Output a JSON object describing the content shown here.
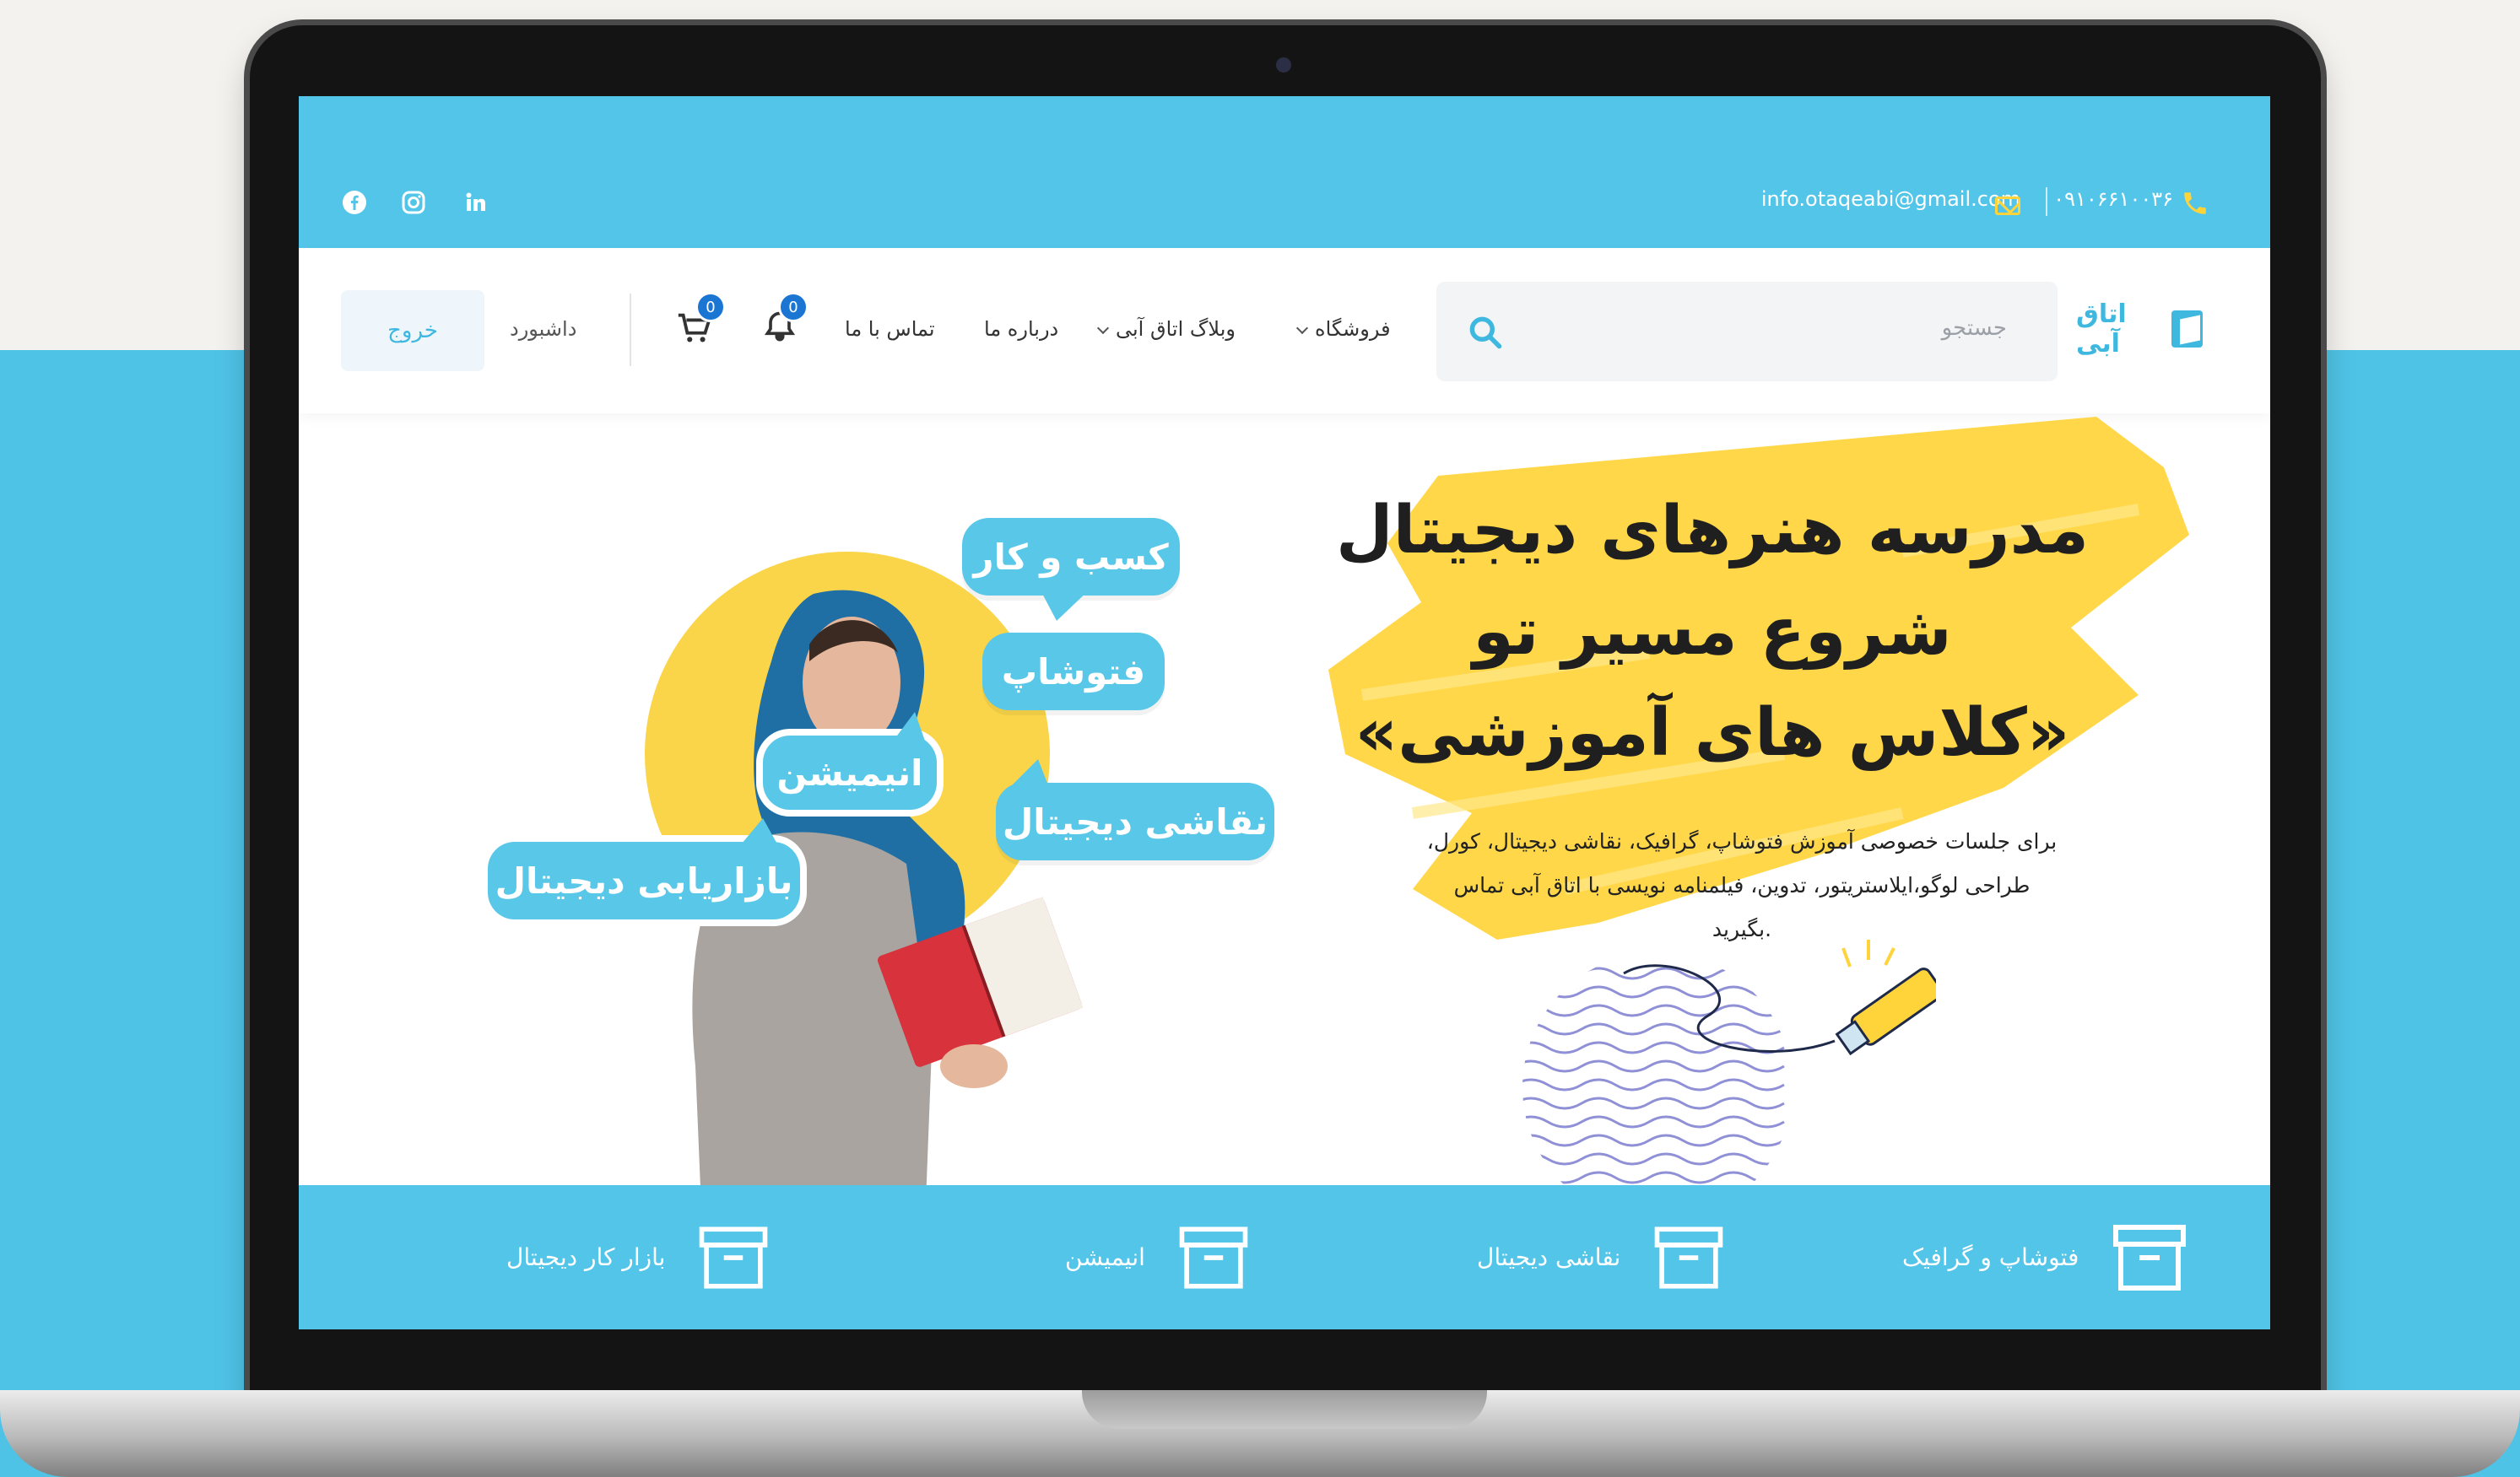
{
  "topbar": {
    "email": "info.otaqeabi@gmail.com",
    "phone": "۰۹۱۰۶۶۱۰۰۳۶",
    "social": [
      "facebook-icon",
      "instagram-icon",
      "linkedin-icon"
    ]
  },
  "header": {
    "logo_text": "اتاق آبی",
    "search_placeholder": "جستجو",
    "nav": {
      "shop": "فروشگاه",
      "blog": "وبلاگ اتاق آبی",
      "about": "درباره ما",
      "contact": "تماس با ما"
    },
    "notifications_count": "0",
    "cart_count": "0",
    "dashboard": "داشبورد",
    "logout": "خروج"
  },
  "hero": {
    "title_line1": "مدرسه هنرهای دیجیتال",
    "title_line2": "شروع مسیر تو",
    "title_line3": "«کلاس های آموزشی»",
    "description": "برای جلسات خصوصی آموزش فتوشاپ، گرافیک، نقاشی دیجیتال، کورل، طراحی لوگو،ایلاستریتور، تدوین، فیلمنامه نویسی با اتاق آبی تماس بگیرید.",
    "bubbles": {
      "business": "کسب و کار",
      "photoshop": "فتوشاپ",
      "animation": "انیمیشن",
      "digital_painting": "نقاشی دیجیتال",
      "digital_marketing": "بازاریابی دیجیتال"
    }
  },
  "categories": [
    {
      "label": "فتوشاپ و گرافیک",
      "icon": "archive-box-icon"
    },
    {
      "label": "نقاشی دیجیتال",
      "icon": "archive-box-icon"
    },
    {
      "label": "انیمیشن",
      "icon": "archive-box-icon"
    },
    {
      "label": "بازار کار دیجیتال",
      "icon": "archive-box-icon"
    }
  ],
  "colors": {
    "brand_blue": "#52c5e8",
    "accent_yellow": "#ffd43a",
    "badge_blue": "#1a76d2"
  }
}
